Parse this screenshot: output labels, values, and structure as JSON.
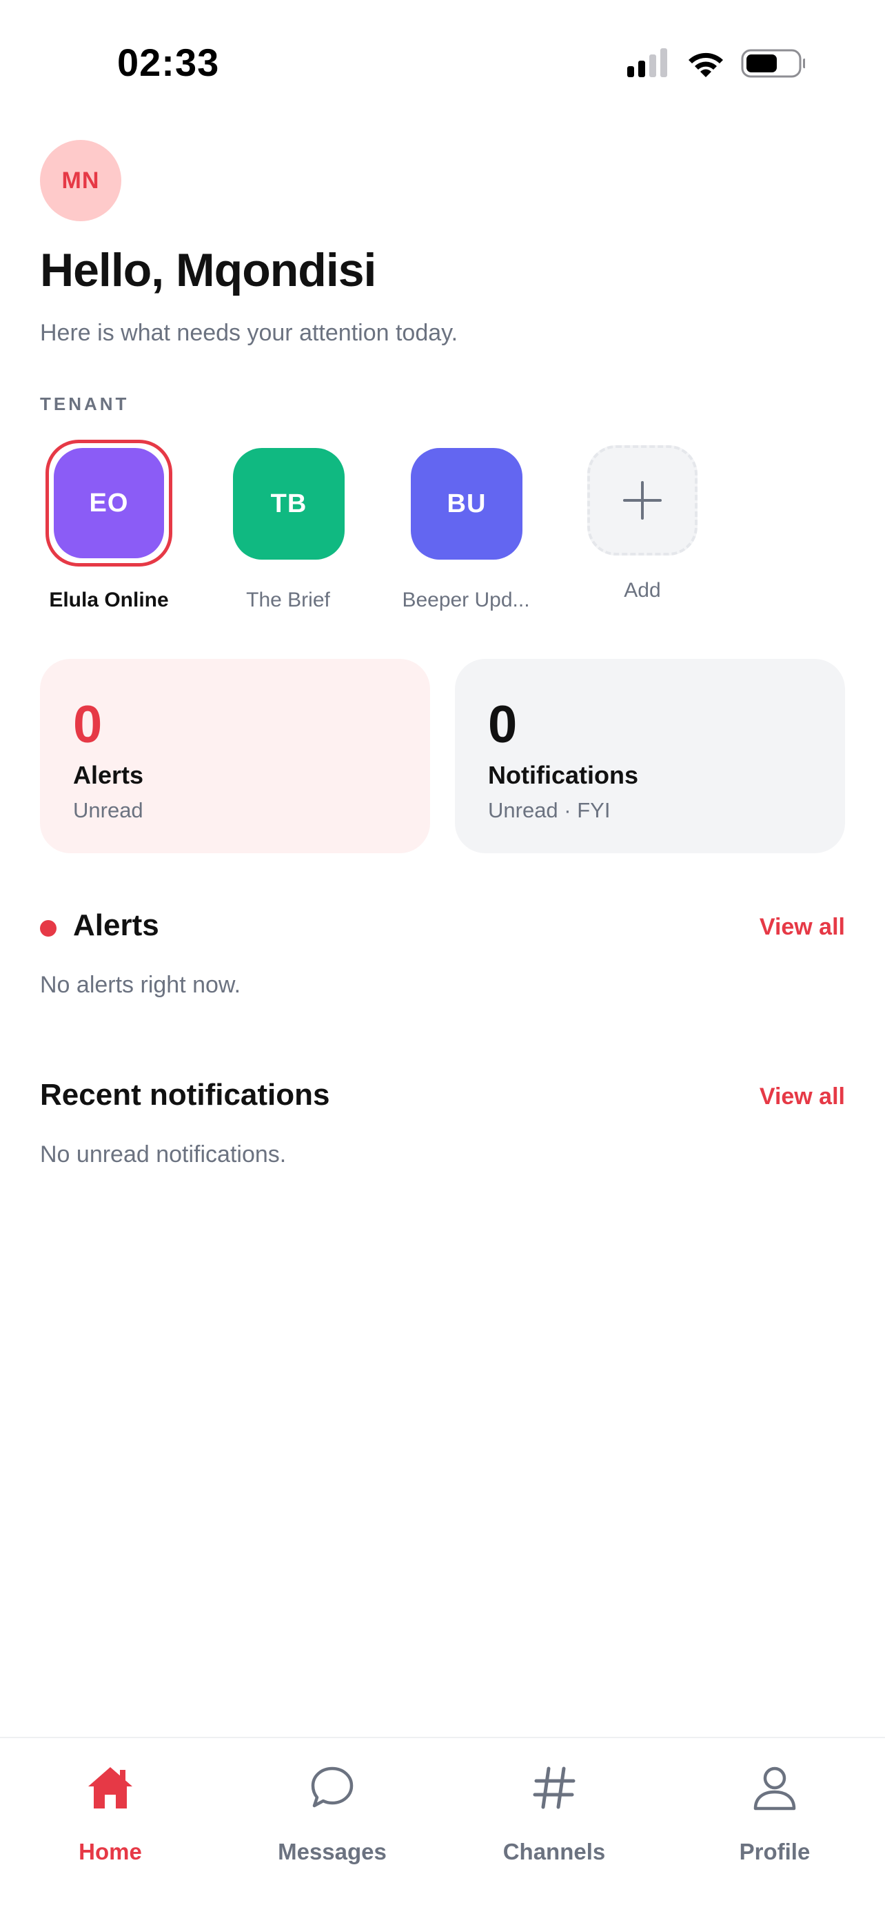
{
  "status_bar": {
    "time": "02:33"
  },
  "header": {
    "avatar_initials": "MN",
    "greeting": "Hello, Mqondisi",
    "subtitle": "Here is what needs your attention today."
  },
  "tenant_section": {
    "label": "TENANT",
    "tenants": [
      {
        "initials": "EO",
        "name": "Elula Online",
        "color": "#8b5cf6",
        "selected": true
      },
      {
        "initials": "TB",
        "name": "The Brief",
        "color": "#10b981",
        "selected": false
      },
      {
        "initials": "BU",
        "name": "Beeper Upd...",
        "color": "#6366f1",
        "selected": false
      }
    ],
    "add_label": "Add"
  },
  "stats": {
    "alerts": {
      "count": "0",
      "title": "Alerts",
      "caption": "Unread",
      "background": "#fef1f1",
      "count_color": "#e63946"
    },
    "notifications": {
      "count": "0",
      "title": "Notifications",
      "caption": "Unread · FYI",
      "background": "#f3f4f6",
      "count_color": "#111111"
    }
  },
  "alerts_section": {
    "title": "Alerts",
    "view_all": "View all",
    "empty_text": "No alerts right now."
  },
  "notifications_section": {
    "title": "Recent notifications",
    "view_all": "View all",
    "empty_text": "No unread notifications."
  },
  "tab_bar": {
    "tabs": [
      {
        "label": "Home",
        "icon": "home-icon",
        "active": true
      },
      {
        "label": "Messages",
        "icon": "chat-bubble-icon",
        "active": false
      },
      {
        "label": "Channels",
        "icon": "hashtag-icon",
        "active": false
      },
      {
        "label": "Profile",
        "icon": "person-icon",
        "active": false
      }
    ]
  },
  "colors": {
    "accent": "#e63946",
    "muted_text": "#6b7280"
  }
}
